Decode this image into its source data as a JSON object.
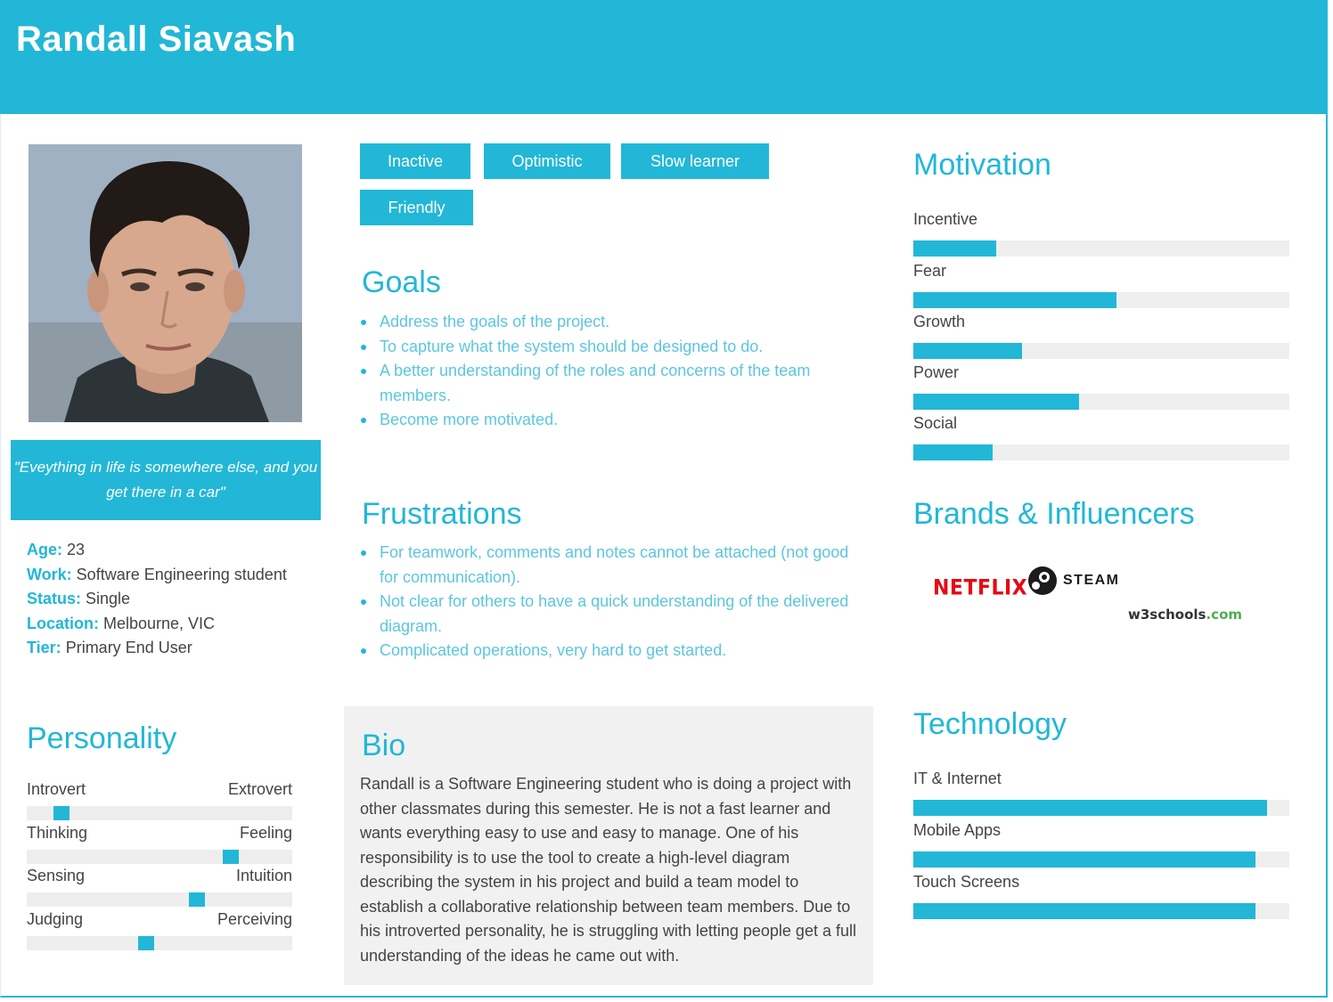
{
  "header": {
    "name": "Randall Siavash"
  },
  "profile": {
    "quote": "\"Eveything in life is somewhere else, and you get there in a car\"",
    "facts": [
      {
        "key": "Age:",
        "value": " 23"
      },
      {
        "key": "Work:",
        "value": " Software Engineering student"
      },
      {
        "key": "Status:",
        "value": " Single"
      },
      {
        "key": "Location:",
        "value": " Melbourne, VIC"
      },
      {
        "key": "Tier:",
        "value": " Primary End User"
      }
    ]
  },
  "personality": {
    "title": "Personality",
    "traits": [
      {
        "left": "Introvert",
        "right": "Extrovert",
        "level": 0.13
      },
      {
        "left": "Thinking",
        "right": "Feeling",
        "level": 0.77
      },
      {
        "left": "Sensing",
        "right": "Intuition",
        "level": 0.64
      },
      {
        "left": "Judging",
        "right": "Perceiving",
        "level": 0.45
      }
    ]
  },
  "tags": [
    "Inactive",
    "Optimistic",
    "Slow learner",
    "Friendly"
  ],
  "goals": {
    "title": "Goals",
    "items": [
      "Address the goals of the project.",
      "To capture what the system should be designed to do.",
      "A better understanding of the roles and concerns of the team members.",
      "Become more motivated."
    ]
  },
  "frustrations": {
    "title": "Frustrations",
    "items": [
      "For teamwork, comments and notes cannot be attached (not good for communication).",
      "Not clear for others to have a quick understanding of the delivered diagram.",
      "Complicated operations, very hard to get started."
    ]
  },
  "bio": {
    "title": "Bio",
    "text": "Randall is a Software Engineering student who is doing a project with other classmates during this semester. He is not a fast learner and wants everything easy to use and easy to manage. One of his responsibility is to use the tool to create a high-level diagram describing the system in his project and build a team model to establish a collaborative relationship between team members. Due to his introverted personality, he is struggling with letting people get a full understanding of the ideas he came out with."
  },
  "motivation": {
    "title": "Motivation",
    "items": [
      {
        "label": "Incentive",
        "level": 0.22
      },
      {
        "label": "Fear",
        "level": 0.54
      },
      {
        "label": "Growth",
        "level": 0.29
      },
      {
        "label": "Power",
        "level": 0.44
      },
      {
        "label": "Social",
        "level": 0.21
      }
    ]
  },
  "brands": {
    "title": "Brands & Influencers",
    "netflix": "NETFLIX",
    "steam": "STEAM",
    "w3_main": "w3schools",
    "w3_tld": ".com"
  },
  "technology": {
    "title": "Technology",
    "items": [
      {
        "label": "IT & Internet",
        "level": 0.94
      },
      {
        "label": "Mobile Apps",
        "level": 0.91
      },
      {
        "label": "Touch Screens",
        "level": 0.91
      }
    ]
  },
  "colors": {
    "accent": "#22b7d6",
    "track": "#efefef",
    "bio_bg": "#f1f1f1"
  }
}
